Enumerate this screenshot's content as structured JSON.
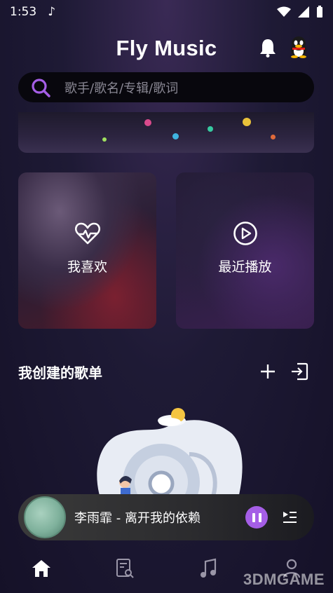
{
  "status": {
    "time": "1:53"
  },
  "app": {
    "title": "Fly Music"
  },
  "search": {
    "placeholder": "歌手/歌名/专辑/歌词"
  },
  "cards": [
    {
      "label": "我喜欢",
      "icon": "heart-pulse-icon"
    },
    {
      "label": "最近播放",
      "icon": "play-circle-icon"
    }
  ],
  "section": {
    "title": "我创建的歌单"
  },
  "player": {
    "song": "李雨霏 - 离开我的依赖"
  },
  "tabs": [
    "home-icon",
    "playlist-search-icon",
    "music-note-icon",
    "user-icon"
  ],
  "watermark": "3DMGAME",
  "colors": {
    "accent": "#a55ee6",
    "background": "#1a1530"
  }
}
